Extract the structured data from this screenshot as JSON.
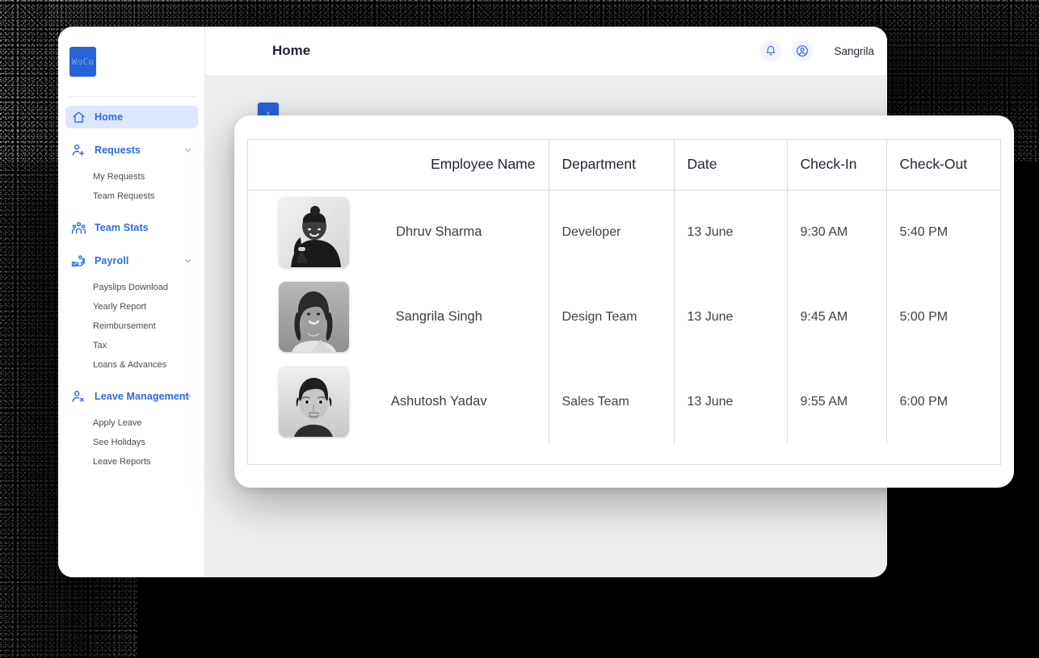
{
  "window": {
    "logo_text": "WoCo"
  },
  "topbar": {
    "title": "Home",
    "bell_icon": "bell-icon",
    "account_icon": "user-circle-icon",
    "username": "Sangrila"
  },
  "content": {
    "collapse_label": "‹"
  },
  "sidebar": {
    "items": [
      {
        "label": "Home",
        "icon": "home-icon",
        "active": true,
        "expandable": false
      },
      {
        "label": "Requests",
        "icon": "user-plus-icon",
        "active": false,
        "expandable": true,
        "children": [
          "My Requests",
          "Team Requests"
        ]
      },
      {
        "label": "Team Stats",
        "icon": "team-icon",
        "active": false,
        "expandable": false
      },
      {
        "label": "Payroll",
        "icon": "payroll-hand-icon",
        "active": false,
        "expandable": true,
        "children": [
          "Payslips Download",
          "Yearly Report",
          "Reimbursement",
          "Tax",
          "Loans & Advances"
        ]
      },
      {
        "label": "Leave Management",
        "icon": "user-minus-icon",
        "active": false,
        "expandable": true,
        "children": [
          "Apply Leave",
          "See Holidays",
          "Leave Reports"
        ]
      }
    ]
  },
  "table": {
    "columns": [
      "Employee Name",
      "Department",
      "Date",
      "Check-In",
      "Check-Out"
    ],
    "rows": [
      {
        "name": "Dhruv Sharma",
        "department": "Developer",
        "date": "13 June",
        "check_in": "9:30 AM",
        "check_out": "5:40 PM",
        "avatar": "photo-person-1"
      },
      {
        "name": "Sangrila Singh",
        "department": "Design Team",
        "date": "13 June",
        "check_in": "9:45 AM",
        "check_out": "5:00 PM",
        "avatar": "photo-person-2"
      },
      {
        "name": "Ashutosh Yadav",
        "department": "Sales Team",
        "date": "13 June",
        "check_in": "9:55 AM",
        "check_out": "6:00 PM",
        "avatar": "photo-person-3"
      }
    ]
  },
  "colors": {
    "brand_blue": "#2563d8",
    "accent_blue": "#2f6ae0",
    "active_pill": "#dce7fb",
    "content_bg": "#eeeef0",
    "border": "#dcdcdf"
  }
}
